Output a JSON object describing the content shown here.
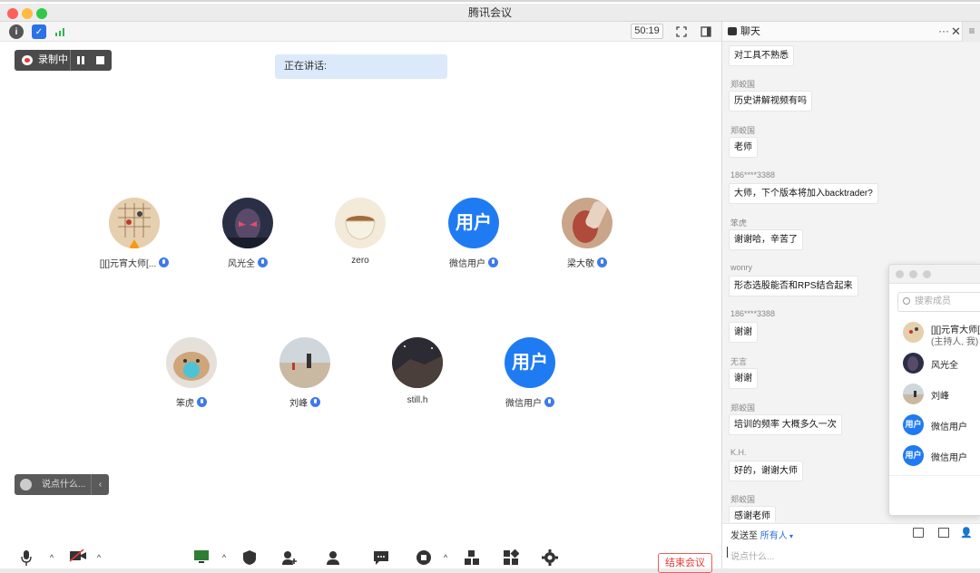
{
  "window": {
    "title": "腾讯会议"
  },
  "toolbar": {
    "timer": "50:19"
  },
  "recording": {
    "label": "录制中"
  },
  "speaking": {
    "label": "正在讲话:"
  },
  "participants": [
    {
      "name": "[][]元宵大师[...",
      "avatar": "image"
    },
    {
      "name": "风光全",
      "avatar": "image"
    },
    {
      "name": "zero",
      "avatar": "image"
    },
    {
      "name": "微信用户",
      "avatar": "用户"
    },
    {
      "name": "梁大敬",
      "avatar": "image"
    },
    {
      "name": "笨虎",
      "avatar": "image"
    },
    {
      "name": "刘峰",
      "avatar": "image"
    },
    {
      "name": "still.h",
      "avatar": "image"
    },
    {
      "name": "微信用户",
      "avatar": "用户"
    }
  ],
  "say": {
    "placeholder": "说点什么..."
  },
  "controls": {
    "end_label": "结束会议"
  },
  "chat": {
    "title": "聊天",
    "messages": [
      {
        "sender": "",
        "text": "对工具不熟悉"
      },
      {
        "sender": "郑蛟国",
        "text": "历史讲解视频有吗"
      },
      {
        "sender": "郑蛟国",
        "text": "老师"
      },
      {
        "sender": "186****3388",
        "text": "大师，下个版本将加入backtrader?"
      },
      {
        "sender": "笨虎",
        "text": "谢谢哈，辛苦了"
      },
      {
        "sender": "wonry",
        "text": "形态选股能否和RPS结合起来"
      },
      {
        "sender": "186****3388",
        "text": "谢谢"
      },
      {
        "sender": "无言",
        "text": "谢谢"
      },
      {
        "sender": "郑蛟国",
        "text": "培训的频率 大概多久一次"
      },
      {
        "sender": "K.H.",
        "text": "好的，谢谢大师"
      },
      {
        "sender": "郑蛟国",
        "text": "感谢老师"
      }
    ],
    "send_to_label": "发送至",
    "send_to_value": "所有人",
    "input_placeholder": "说点什么..."
  },
  "members": {
    "search_placeholder": "搜索成员",
    "list": [
      {
        "name": "[][]元宵大师[",
        "sub": "(主持人, 我)",
        "avatar": "image"
      },
      {
        "name": "风光全",
        "sub": "",
        "avatar": "image"
      },
      {
        "name": "刘峰",
        "sub": "",
        "avatar": "image"
      },
      {
        "name": "微信用户",
        "sub": "",
        "avatar": "用户"
      },
      {
        "name": "微信用户",
        "sub": "",
        "avatar": "用户"
      }
    ]
  },
  "colors": {
    "accent": "#1f7bf2",
    "end_red": "#e53935",
    "speaking_bg": "#dce9fb"
  }
}
